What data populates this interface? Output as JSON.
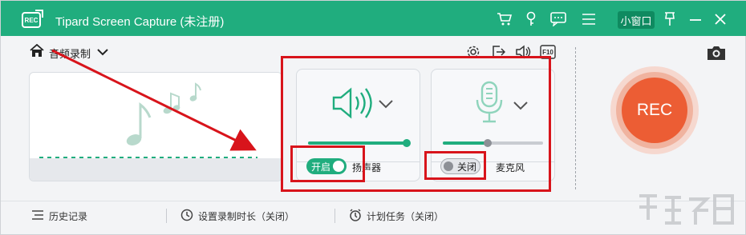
{
  "app": {
    "logo_text": "REC",
    "title": "Tipard Screen Capture (未注册)",
    "mini_window_label": "小窗口",
    "accent": "#20ad7e"
  },
  "titlebar_icons": [
    "cart-icon",
    "key-icon",
    "chat-icon",
    "menu-icon",
    "pin-icon",
    "minimize-icon",
    "close-icon"
  ],
  "breadcrumb": {
    "label": "音频录制"
  },
  "toolbar_icons": [
    "gear-icon",
    "export-icon",
    "volume-icon",
    "f10-icon"
  ],
  "toolbar_f10": "F10",
  "speaker": {
    "label": "扬声器",
    "toggle_label": "开启",
    "enabled": true,
    "volume": 1.0
  },
  "microphone": {
    "label": "麦克风",
    "toggle_label": "关闭",
    "enabled": false,
    "volume": 0.45
  },
  "rec_button": {
    "label": "REC",
    "color": "#ec5d34"
  },
  "bottom": {
    "history": "历史记录",
    "set_duration": "设置录制时长（关闭）",
    "schedule": "计划任务（关闭）"
  },
  "annotation_color": "#d8141b"
}
